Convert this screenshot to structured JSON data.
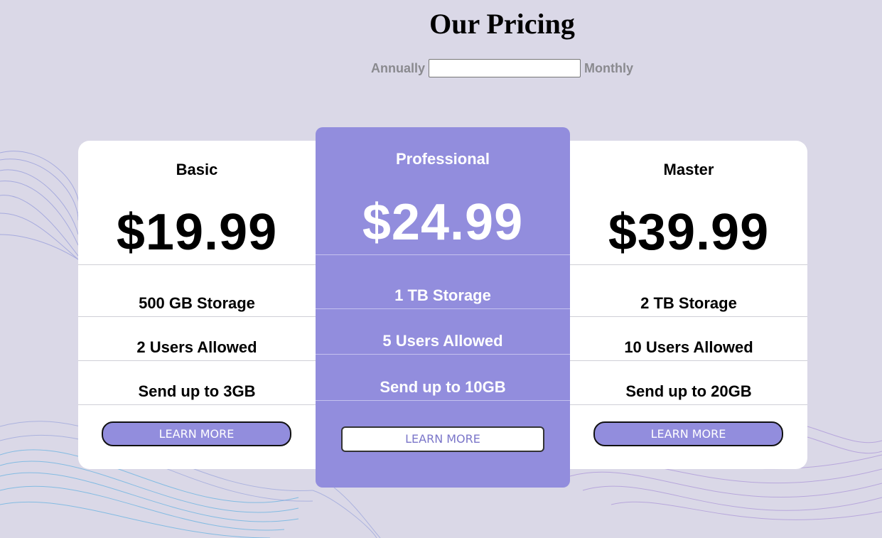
{
  "header": {
    "title": "Our Pricing"
  },
  "billing_toggle": {
    "left_label": "Annually",
    "right_label": "Monthly",
    "value": ""
  },
  "plans": [
    {
      "name": "Basic",
      "price": "$19.99",
      "features": [
        "500 GB Storage",
        "2 Users Allowed",
        "Send up to 3GB"
      ],
      "button_label": "LEARN MORE"
    },
    {
      "name": "Professional",
      "price": "$24.99",
      "features": [
        "1 TB Storage",
        "5 Users Allowed",
        "Send up to 10GB"
      ],
      "button_label": "LEARN MORE"
    },
    {
      "name": "Master",
      "price": "$39.99",
      "features": [
        "2 TB Storage",
        "10 Users Allowed",
        "Send up to 20GB"
      ],
      "button_label": "LEARN MORE"
    }
  ],
  "colors": {
    "background": "#dad8e7",
    "accent": "#928ddd",
    "card": "#ffffff",
    "toggle_label": "#8a8a8f"
  }
}
